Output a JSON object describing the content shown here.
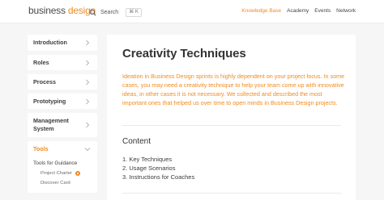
{
  "header": {
    "logo_primary": "business",
    "logo_accent": "design",
    "search_label": "Search",
    "search_shortcut": "⌘ K",
    "nav": [
      "Knowledge Base",
      "Academy",
      "Events",
      "Network"
    ],
    "nav_active": "Knowledge Base",
    "accent_color": "#f28a1e"
  },
  "sidebar": {
    "items": [
      {
        "label": "Introduction",
        "icon": "chevron-right-icon"
      },
      {
        "label": "Roles",
        "icon": "chevron-right-icon"
      },
      {
        "label": "Process",
        "icon": "chevron-right-icon"
      },
      {
        "label": "Prototyping",
        "icon": "chevron-right-icon"
      },
      {
        "label": "Management System",
        "icon": "chevron-right-icon"
      },
      {
        "label": "Tools",
        "icon": "chevron-down-icon",
        "active": true
      }
    ],
    "subsection": {
      "title": "Tools for Guidance",
      "items": [
        "Project Charter",
        "Discover Card"
      ]
    }
  },
  "main": {
    "title": "Creativity Techniques",
    "intro": "Ideation in Business Design sprints is highly dependent on your project focus. In some cases, you may need a creativity technique to help your team come up with innovative ideas, in other cases it is not necessary. We collected and described the most important ones that helped us over time to open minds in Business Design projects.",
    "content_heading": "Content",
    "toc": [
      "1. Key Techniques",
      "2. Usage Scenarios",
      "3. Instructions for Coaches"
    ]
  }
}
